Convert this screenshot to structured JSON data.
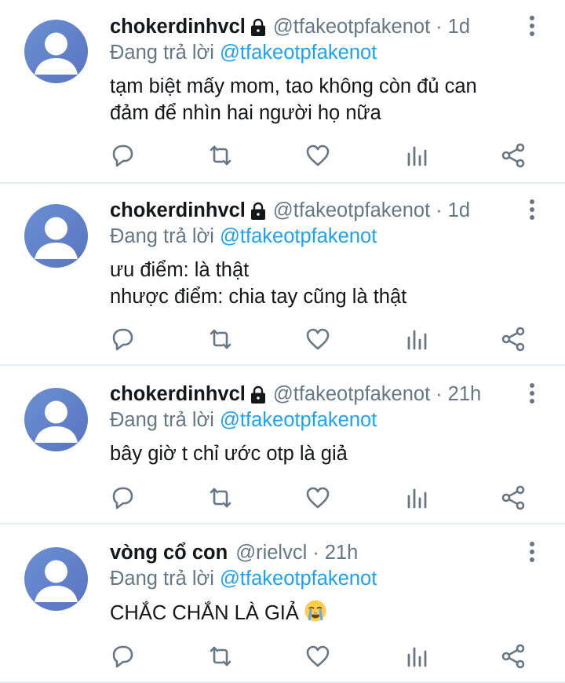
{
  "tweets": [
    {
      "name": "chokerdinhvcl",
      "locked": true,
      "handle": "@tfakeotpfakenot",
      "separator": "·",
      "time": "1d",
      "reply_prefix": "Đang trả lời",
      "reply_to": "@tfakeotpfakenot",
      "text": "tạm biệt mấy mom, tao không còn đủ can\nđảm để nhìn hai người họ nữa"
    },
    {
      "name": "chokerdinhvcl",
      "locked": true,
      "handle": "@tfakeotpfakenot",
      "separator": "·",
      "time": "1d",
      "reply_prefix": "Đang trả lời",
      "reply_to": "@tfakeotpfakenot",
      "text": "ưu điểm: là thật\nnhược điểm: chia tay cũng là thật"
    },
    {
      "name": "chokerdinhvcl",
      "locked": true,
      "handle": "@tfakeotpfakenot",
      "separator": "·",
      "time": "21h",
      "reply_prefix": "Đang trả lời",
      "reply_to": "@tfakeotpfakenot",
      "text": "bây giờ t chỉ ước otp là giả"
    },
    {
      "name": "vòng cổ con",
      "locked": false,
      "handle": "@rielvcl",
      "separator": "·",
      "time": "21h",
      "reply_prefix": "Đang trả lời",
      "reply_to": "@tfakeotpfakenot",
      "text": "CHẮC CHẮN LÀ GIẢ",
      "emoji": "loudly-crying-face-icon"
    }
  ],
  "colors": {
    "text": "#14171a",
    "secondary": "#657786",
    "link": "#1da1f2",
    "icon": "#687684",
    "avatar_bg": "#5f7fc6",
    "divider": "#e6ecf0"
  },
  "icons": [
    "avatar-placeholder-icon",
    "lock-icon",
    "more-vertical-icon",
    "reply-icon",
    "retweet-icon",
    "like-icon",
    "analytics-icon",
    "share-icon"
  ]
}
